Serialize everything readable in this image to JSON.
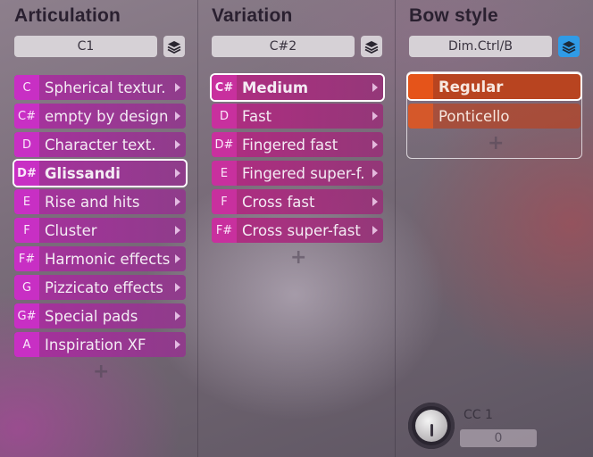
{
  "articulation": {
    "title": "Articulation",
    "selector": "C1",
    "items": [
      {
        "key": "C",
        "label": "Spherical textur.",
        "selected": false
      },
      {
        "key": "C#",
        "label": "empty by design",
        "selected": false
      },
      {
        "key": "D",
        "label": "Character text.",
        "selected": false
      },
      {
        "key": "D#",
        "label": "Glissandi",
        "selected": true
      },
      {
        "key": "E",
        "label": "Rise and hits",
        "selected": false
      },
      {
        "key": "F",
        "label": "Cluster",
        "selected": false
      },
      {
        "key": "F#",
        "label": "Harmonic effects",
        "selected": false
      },
      {
        "key": "G",
        "label": "Pizzicato effects",
        "selected": false
      },
      {
        "key": "G#",
        "label": "Special pads",
        "selected": false
      },
      {
        "key": "A",
        "label": "Inspiration XF",
        "selected": false
      }
    ],
    "add_label": "+"
  },
  "variation": {
    "title": "Variation",
    "selector": "C#2",
    "items": [
      {
        "key": "C#",
        "label": "Medium",
        "selected": true
      },
      {
        "key": "D",
        "label": "Fast",
        "selected": false
      },
      {
        "key": "D#",
        "label": "Fingered fast",
        "selected": false
      },
      {
        "key": "E",
        "label": "Fingered super-f.",
        "selected": false
      },
      {
        "key": "F",
        "label": "Cross fast",
        "selected": false
      },
      {
        "key": "F#",
        "label": "Cross super-fast",
        "selected": false
      }
    ],
    "add_label": "+"
  },
  "bow_style": {
    "title": "Bow style",
    "selector": "Dim.Ctrl/B",
    "items": [
      {
        "label": "Regular",
        "selected": true
      },
      {
        "label": "Ponticello",
        "selected": false
      }
    ],
    "add_label": "+"
  },
  "cc": {
    "label": "CC 1",
    "value": "0"
  },
  "colors": {
    "articulation_key": "#c82fc4",
    "variation_key": "#c8309e",
    "bow_key": "#e5541a",
    "layer_active": "#2f9be6"
  },
  "icons": {
    "layer": "layers-icon",
    "arrow": "chevron-right-icon",
    "add": "plus-icon"
  }
}
